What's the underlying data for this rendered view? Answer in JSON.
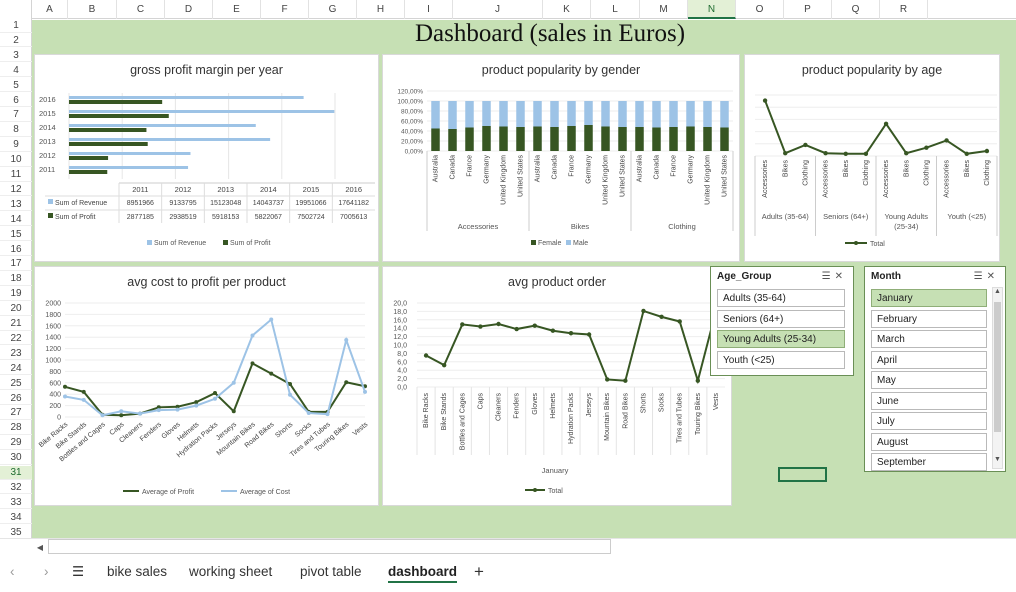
{
  "col_headers": [
    "A",
    "B",
    "C",
    "D",
    "E",
    "F",
    "G",
    "H",
    "I",
    "J",
    "K",
    "L",
    "M",
    "N",
    "O",
    "P",
    "Q",
    "R"
  ],
  "row_headers": [
    "1",
    "2",
    "3",
    "4",
    "5",
    "6",
    "7",
    "8",
    "9",
    "10",
    "11",
    "12",
    "13",
    "14",
    "15",
    "16",
    "17",
    "18",
    "19",
    "20",
    "21",
    "22",
    "23",
    "24",
    "25",
    "26",
    "27",
    "28",
    "29",
    "30",
    "31",
    "32",
    "33",
    "34",
    "35"
  ],
  "selected_col": "N",
  "selected_row": "31",
  "dashboard_title": "Dashboard (sales in Euros)",
  "colors": {
    "revenue": "#9dc3e6",
    "profit": "#375623",
    "grid_bg": "#c6e0b4",
    "accent": "#217346"
  },
  "chart_data": [
    {
      "id": "gpm",
      "type": "bar",
      "title": "gross profit margin per year",
      "categories": [
        "2011",
        "2012",
        "2013",
        "2014",
        "2015",
        "2016"
      ],
      "series": [
        {
          "name": "Sum of Revenue",
          "values": [
            8951966,
            9133795,
            15123048,
            14043737,
            19951066,
            17641182
          ]
        },
        {
          "name": "Sum of Profit",
          "values": [
            2877185,
            2938519,
            5918153,
            5822067,
            7502724,
            7005613
          ]
        }
      ],
      "table_row_labels": [
        "Sum of Revenue",
        "Sum of Profit"
      ],
      "table_values": [
        [
          "8951966",
          "9133795",
          "15123048",
          "14043737",
          "19951066",
          "17641182"
        ],
        [
          "2877185",
          "2938519",
          "5918153",
          "5822067",
          "7502724",
          "7005613"
        ]
      ]
    },
    {
      "id": "gender",
      "type": "bar",
      "title": "product popularity by gender",
      "groups": [
        "Accessories",
        "Bikes",
        "Clothing"
      ],
      "countries": [
        "Australia",
        "Canada",
        "France",
        "Germany",
        "United Kingdom",
        "United States"
      ],
      "yticks": [
        "0,00%",
        "20,00%",
        "40,00%",
        "60,00%",
        "80,00%",
        "100,00%",
        "120,00%"
      ],
      "series": [
        {
          "name": "Female",
          "values": [
            45,
            44,
            47,
            50,
            49,
            48,
            49,
            48,
            50,
            52,
            49,
            48,
            48,
            47,
            48,
            49,
            48,
            47
          ]
        },
        {
          "name": "Male",
          "values": [
            55,
            56,
            53,
            50,
            51,
            52,
            51,
            52,
            50,
            48,
            51,
            52,
            52,
            53,
            52,
            51,
            52,
            53
          ]
        }
      ]
    },
    {
      "id": "age",
      "type": "line",
      "title": "product popularity by age",
      "groups": [
        "Adults (35-64)",
        "Seniors (64+)",
        "Young Adults (25-34)",
        "Youth (<25)"
      ],
      "categories": [
        "Accessories",
        "Bikes",
        "Clothing",
        "Accessories",
        "Bikes",
        "Clothing",
        "Accessories",
        "Bikes",
        "Clothing",
        "Accessories",
        "Bikes",
        "Clothing"
      ],
      "series": [
        {
          "name": "Total",
          "values": [
            100,
            5,
            20,
            5,
            4,
            4,
            58,
            5,
            15,
            28,
            4,
            9
          ]
        }
      ]
    },
    {
      "id": "avgcost",
      "type": "line",
      "title": "avg cost to profit per product",
      "yticks": [
        "0",
        "200",
        "400",
        "600",
        "800",
        "1000",
        "1200",
        "1400",
        "1600",
        "1800",
        "2000"
      ],
      "categories": [
        "Bike Racks",
        "Bike Stands",
        "Bottles and Cages",
        "Caps",
        "Cleaners",
        "Fenders",
        "Gloves",
        "Helmets",
        "Hydration Packs",
        "Jerseys",
        "Mountain Bikes",
        "Road Bikes",
        "Shorts",
        "Socks",
        "Tires and Tubes",
        "Touring Bikes",
        "Vests"
      ],
      "series": [
        {
          "name": "Average of Profit",
          "values": [
            530,
            440,
            40,
            30,
            60,
            170,
            180,
            260,
            420,
            100,
            940,
            760,
            580,
            90,
            90,
            610,
            540
          ]
        },
        {
          "name": "Average of Cost",
          "values": [
            360,
            300,
            30,
            100,
            60,
            120,
            130,
            200,
            320,
            600,
            1430,
            1710,
            390,
            70,
            50,
            1350,
            440
          ]
        }
      ]
    },
    {
      "id": "avgorder",
      "type": "line",
      "title": "avg product order",
      "xlabel": "January",
      "yticks": [
        "0,0",
        "2,0",
        "4,0",
        "6,0",
        "8,0",
        "10,0",
        "12,0",
        "14,0",
        "16,0",
        "18,0",
        "20,0"
      ],
      "categories": [
        "Bike Racks",
        "Bike Stands",
        "Bottles and Cages",
        "Caps",
        "Cleaners",
        "Fenders",
        "Gloves",
        "Helmets",
        "Hydration Packs",
        "Jerseys",
        "Mountain Bikes",
        "Road Bikes",
        "Shorts",
        "Socks",
        "Tires and Tubes",
        "Touring Bikes",
        "Vests"
      ],
      "series": [
        {
          "name": "Total",
          "values": [
            7.5,
            5.2,
            14.9,
            14.4,
            15.0,
            13.8,
            14.6,
            13.4,
            12.8,
            12.5,
            1.8,
            1.5,
            18.1,
            16.7,
            15.6,
            1.5,
            18.1
          ]
        }
      ]
    }
  ],
  "slicers": {
    "age": {
      "title": "Age_Group",
      "items": [
        "Adults (35-64)",
        "Seniors (64+)",
        "Young Adults (25-34)",
        "Youth (<25)"
      ],
      "selected": [
        2
      ]
    },
    "month": {
      "title": "Month",
      "items": [
        "January",
        "February",
        "March",
        "April",
        "May",
        "June",
        "July",
        "August",
        "September"
      ],
      "selected": [
        0
      ]
    }
  },
  "tabs": [
    {
      "label": "bike sales"
    },
    {
      "label": "working sheet"
    },
    {
      "label": "pivot table"
    },
    {
      "label": "dashboard",
      "active": true
    }
  ],
  "nav": {
    "prev": "‹",
    "next": "›",
    "menu": "☰",
    "add": "+",
    "scroll_left": "◀",
    "scroll_up": "▲",
    "scroll_down": "▼"
  }
}
